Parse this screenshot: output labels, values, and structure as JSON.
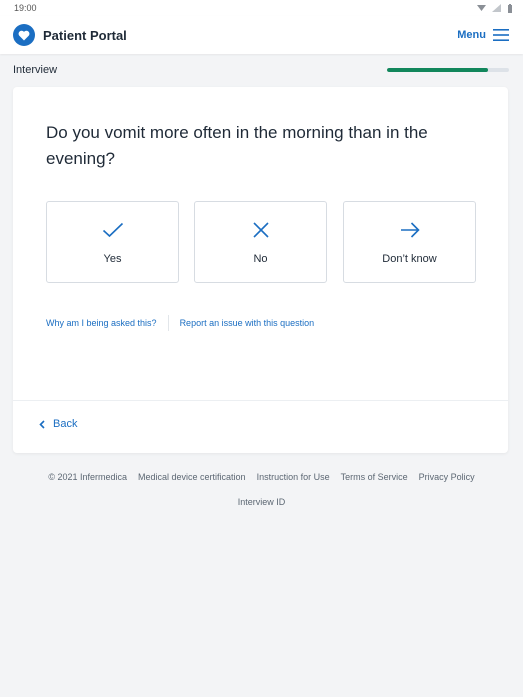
{
  "statusbar": {
    "time": "19:00"
  },
  "appbar": {
    "title": "Patient Portal",
    "menu_label": "Menu"
  },
  "progress": {
    "label": "Interview",
    "fraction": 0.83,
    "color": "#12875c"
  },
  "question": {
    "text": "Do you vomit more often in the morning than in the evening?"
  },
  "answers": [
    {
      "label": "Yes",
      "icon": "check-icon"
    },
    {
      "label": "No",
      "icon": "x-icon"
    },
    {
      "label": "Don’t know",
      "icon": "arrow-right-icon"
    }
  ],
  "links": {
    "why": "Why am I being asked this?",
    "report": "Report an issue with this question"
  },
  "nav": {
    "back_label": "Back"
  },
  "footer": {
    "copyright": "© 2021 Infermedica",
    "certification": "Medical device certification",
    "instructions": "Instruction for Use",
    "terms": "Terms of Service",
    "privacy": "Privacy Policy",
    "interview_id": "Interview ID"
  },
  "colors": {
    "accent": "#1b6ec2",
    "background": "#f3f4f6"
  }
}
